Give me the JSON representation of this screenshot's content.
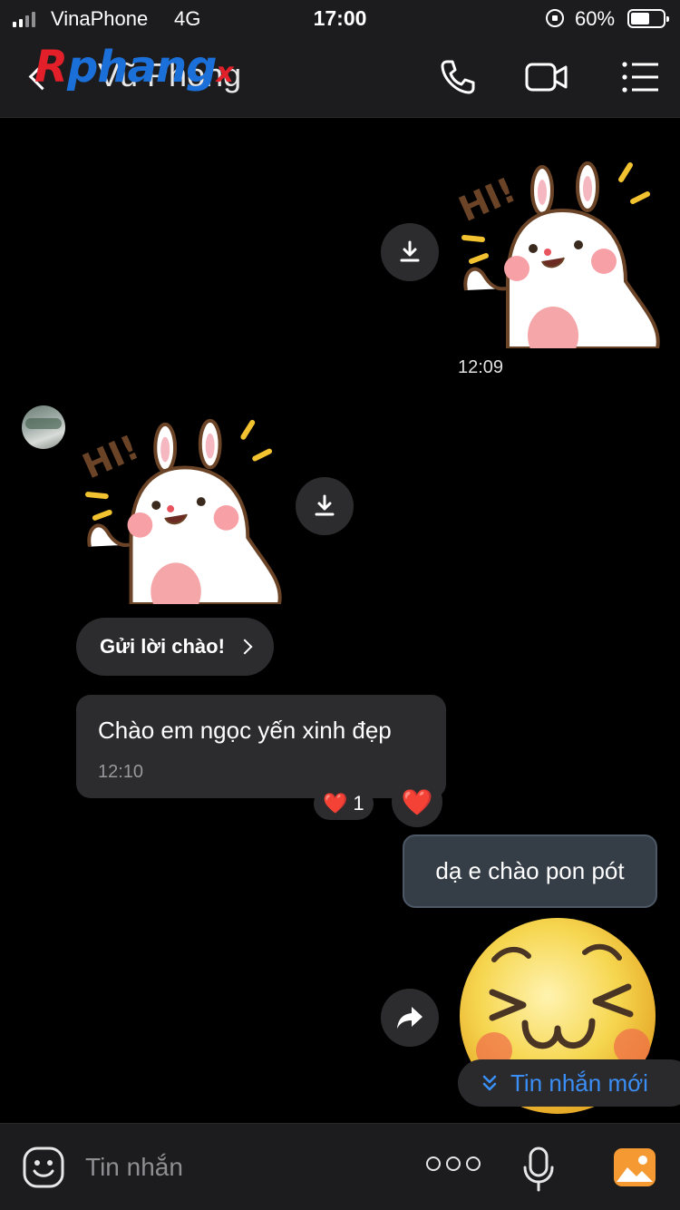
{
  "status_bar": {
    "carrier": "VinaPhone",
    "network": "4G",
    "time": "17:00",
    "battery": "60%"
  },
  "header": {
    "contact_name": "Vũ Phong",
    "watermark": {
      "part1": "R",
      "part2": "phang",
      "part3": "x"
    },
    "icons": [
      "back-arrow-icon",
      "phone-icon",
      "video-camera-icon",
      "menu-list-icon"
    ]
  },
  "messages": {
    "outgoing_sticker_time": "12:09",
    "greet_button_label": "Gửi lời chào!",
    "incoming_text": "Chào em ngọc yến xinh đẹp",
    "incoming_time": "12:10",
    "reaction_emoji": "❤️",
    "reaction_count": "1",
    "reaction_button_emoji": "❤️",
    "outgoing_text": "dạ e chào pon pót",
    "new_message_label": "Tin nhắn mới",
    "sticker_text": "HI!"
  },
  "bottom_bar": {
    "input_placeholder": "Tin nhắn"
  },
  "colors": {
    "background": "#000000",
    "bar": "#1c1c1e",
    "incoming_bubble": "#2c2c2e",
    "outgoing_bubble": "#353d47",
    "accent": "#3a8ef6",
    "heart": "#e8232e"
  }
}
